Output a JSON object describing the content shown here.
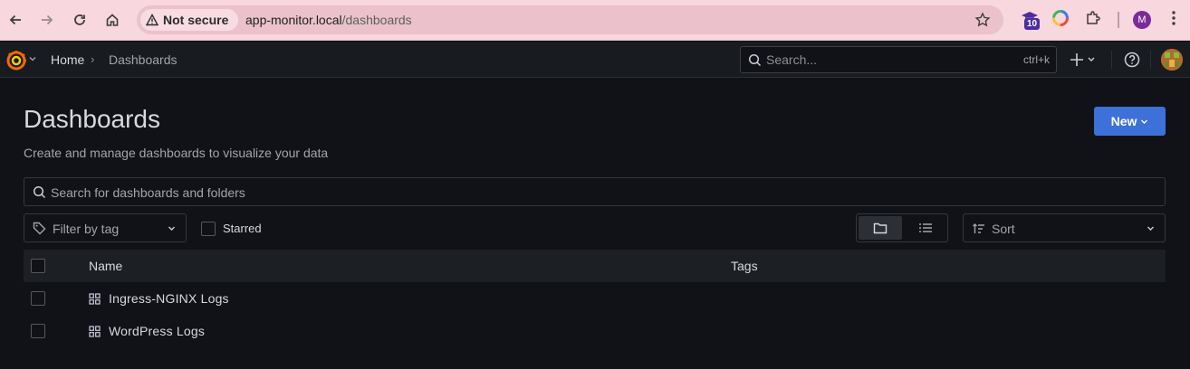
{
  "browser": {
    "security_label": "Not secure",
    "url_host": "app-monitor.local",
    "url_path": "/dashboards",
    "extension_badge": "10",
    "profile_initial": "M"
  },
  "topbar": {
    "breadcrumb_home": "Home",
    "breadcrumb_sep": "›",
    "breadcrumb_current": "Dashboards",
    "search_placeholder": "Search...",
    "search_shortcut": "ctrl+k"
  },
  "page": {
    "title": "Dashboards",
    "subtitle": "Create and manage dashboards to visualize your data",
    "new_button": "New",
    "search_placeholder": "Search for dashboards and folders",
    "tag_filter_placeholder": "Filter by tag",
    "starred_label": "Starred",
    "sort_label": "Sort",
    "view_mode": "folder"
  },
  "table": {
    "columns": [
      "Name",
      "Tags"
    ],
    "rows": [
      {
        "name": "Ingress-NGINX Logs",
        "tags": ""
      },
      {
        "name": "WordPress Logs",
        "tags": ""
      }
    ]
  },
  "colors": {
    "accent": "#3d71d9",
    "background": "#111217",
    "topbar": "#181b1f",
    "browser_chrome": "#f8d7de"
  }
}
